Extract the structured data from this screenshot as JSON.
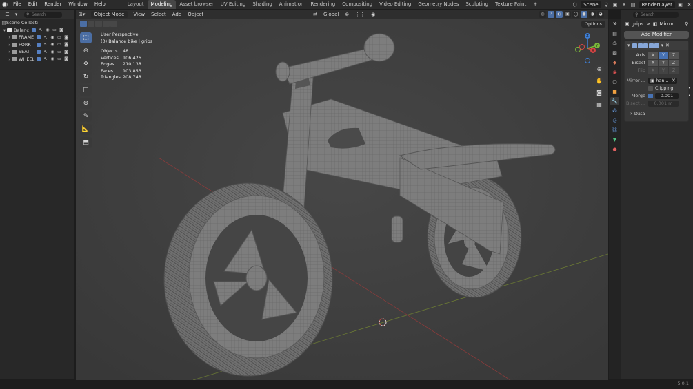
{
  "menu": [
    "File",
    "Edit",
    "Render",
    "Window",
    "Help"
  ],
  "workspaces": [
    "Layout",
    "Modeling",
    "Asset browser",
    "UV Editing",
    "Shading",
    "Animation",
    "Rendering",
    "Compositing",
    "Video Editing",
    "Geometry Nodes",
    "Sculpting",
    "Texture Paint",
    "+"
  ],
  "active_workspace": "Modeling",
  "topbar": {
    "scene": "Scene",
    "render_layer": "RenderLayer",
    "search_placeholder": "Search"
  },
  "outliner": {
    "root": "Scene Collecti",
    "search_placeholder": "Search",
    "items": [
      {
        "label": "Balanc"
      },
      {
        "label": "FRAME"
      },
      {
        "label": "FORK"
      },
      {
        "label": "SEAT"
      },
      {
        "label": "WHEEL"
      }
    ]
  },
  "viewport": {
    "mode": "Object Mode",
    "menus": [
      "View",
      "Select",
      "Add",
      "Object"
    ],
    "orientation": "Global",
    "options": "Options",
    "perspective": "User Perspective",
    "active": "(0) Balance bike | grips",
    "stats": [
      {
        "k": "Objects",
        "v": "48"
      },
      {
        "k": "Vertices",
        "v": "106,426"
      },
      {
        "k": "Edges",
        "v": "210,138"
      },
      {
        "k": "Faces",
        "v": "103,853"
      },
      {
        "k": "Triangles",
        "v": "208,748"
      }
    ],
    "gizmo": {
      "x": "X",
      "y": "Y",
      "z": "Z"
    }
  },
  "properties": {
    "search_placeholder": "Search",
    "breadcrumb_object": "grips",
    "breadcrumb_sep": ">",
    "breadcrumb_modifier": "Mirror",
    "add_modifier": "Add Modifier",
    "axis_label": "Axis",
    "bisect_label": "Bisect",
    "flip_label": "Flip",
    "mirror_label": "Mirror ...",
    "mirror_value": "han...",
    "clipping_label": "Clipping",
    "merge_label": "Merge",
    "merge_value": "0.001",
    "bisect_dist_label": "Bisect ...",
    "bisect_dist_value": "0.001 m",
    "data_label": "Data",
    "axes": [
      "X",
      "Y",
      "Z"
    ]
  },
  "version": "5.0.1"
}
